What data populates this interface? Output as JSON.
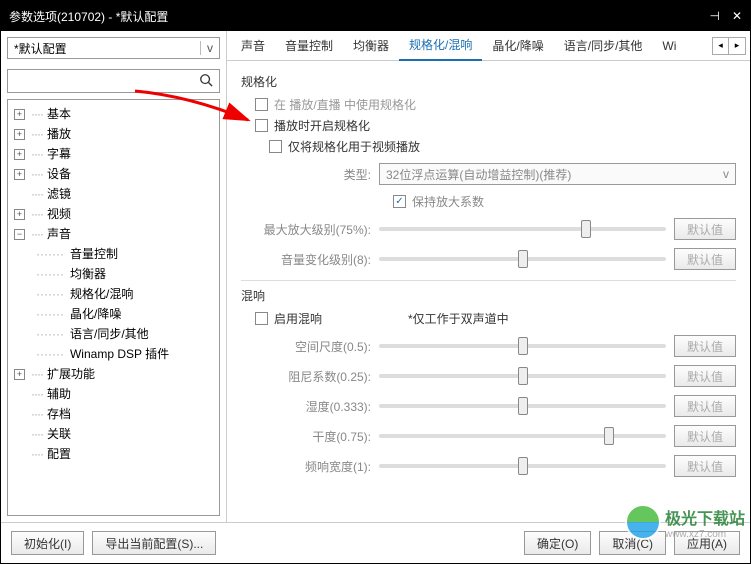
{
  "window": {
    "title": "参数选项(210702) - *默认配置"
  },
  "profile": {
    "selected": "*默认配置"
  },
  "tree": [
    {
      "label": "基本",
      "expandable": true,
      "expanded": false
    },
    {
      "label": "播放",
      "expandable": true,
      "expanded": false
    },
    {
      "label": "字幕",
      "expandable": true,
      "expanded": false
    },
    {
      "label": "设备",
      "expandable": true,
      "expanded": false
    },
    {
      "label": "滤镜",
      "expandable": false
    },
    {
      "label": "视频",
      "expandable": true,
      "expanded": false
    },
    {
      "label": "声音",
      "expandable": true,
      "expanded": true,
      "children": [
        {
          "label": "音量控制"
        },
        {
          "label": "均衡器"
        },
        {
          "label": "规格化/混响"
        },
        {
          "label": "晶化/降噪"
        },
        {
          "label": "语言/同步/其他"
        },
        {
          "label": "Winamp DSP 插件"
        }
      ]
    },
    {
      "label": "扩展功能",
      "expandable": true,
      "expanded": false
    },
    {
      "label": "辅助",
      "expandable": false
    },
    {
      "label": "存档",
      "expandable": false
    },
    {
      "label": "关联",
      "expandable": false
    },
    {
      "label": "配置",
      "expandable": false
    }
  ],
  "tabs": {
    "items": [
      "声音",
      "音量控制",
      "均衡器",
      "规格化/混响",
      "晶化/降噪",
      "语言/同步/其他",
      "Wi"
    ],
    "active_index": 3
  },
  "normalize": {
    "group_title": "规格化",
    "chk_use_in_play": "在 播放/直播 中使用规格化",
    "chk_enable_on_play": "播放时开启规格化",
    "chk_video_only": "仅将规格化用于视频播放",
    "type_label": "类型:",
    "type_value": "32位浮点运算(自动增益控制)(推荐)",
    "chk_keep_factor": "保持放大系数",
    "chk_keep_factor_checked": true,
    "max_amp_label": "最大放大级别(75%):",
    "vol_change_label": "音量变化级别(8):",
    "default_btn": "默认值"
  },
  "reverb": {
    "group_title": "混响",
    "chk_enable": "启用混响",
    "note": "*仅工作于双声道中",
    "room_label": "空间尺度(0.5):",
    "damp_label": "阻尼系数(0.25):",
    "wet_label": "湿度(0.333):",
    "dry_label": "干度(0.75):",
    "width_label": "频响宽度(1):",
    "default_btn": "默认值"
  },
  "footer": {
    "init": "初始化(I)",
    "export": "导出当前配置(S)...",
    "ok": "确定(O)",
    "cancel": "取消(C)",
    "apply": "应用(A)"
  },
  "watermark": {
    "name": "极光下载站",
    "url": "www.xz7.com"
  }
}
